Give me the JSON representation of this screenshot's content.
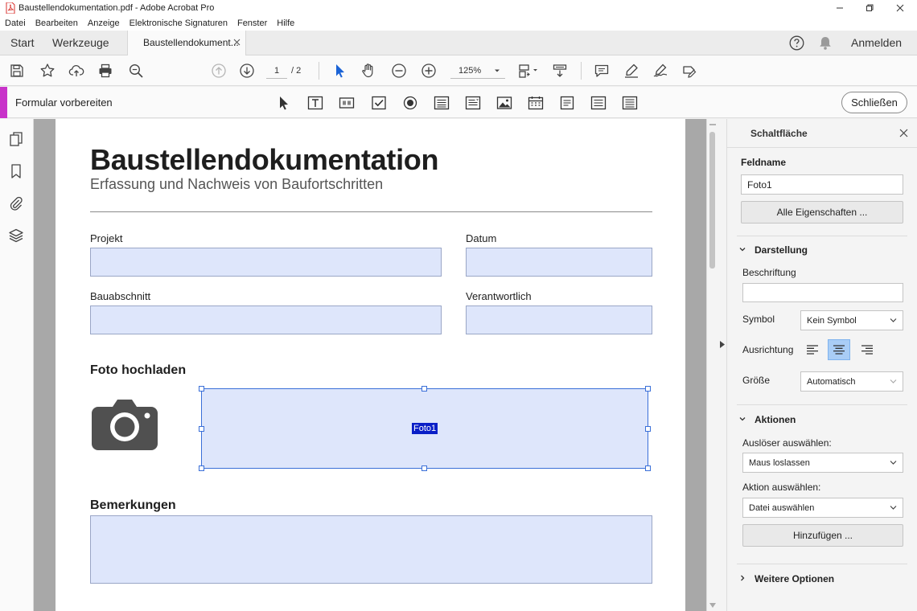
{
  "window": {
    "title": "Baustellendokumentation.pdf - Adobe Acrobat Pro"
  },
  "menu": [
    "Datei",
    "Bearbeiten",
    "Anzeige",
    "Elektronische Signaturen",
    "Fenster",
    "Hilfe"
  ],
  "tabs": {
    "start": "Start",
    "tools": "Werkzeuge",
    "document": "Baustellendokument...",
    "signin": "Anmelden"
  },
  "toolbar": {
    "page_current": "1",
    "page_total": "/ 2",
    "zoom": "125%"
  },
  "form_bar": {
    "title": "Formular vorbereiten",
    "close_label": "Schließen",
    "accent_color": "#c833c9"
  },
  "document": {
    "title": "Baustellendokumentation",
    "subtitle": "Erfassung und Nachweis von Baufortschritten",
    "labels": {
      "projekt": "Projekt",
      "datum": "Datum",
      "bauabschnitt": "Bauabschnitt",
      "verantwortlich": "Verantwortlich"
    },
    "photo_section": "Foto hochladen",
    "photo_field_tag": "Foto1",
    "remarks_section": "Bemerkungen"
  },
  "panel": {
    "header": "Schaltfläche",
    "field_name_label": "Feldname",
    "field_name_value": "Foto1",
    "all_properties": "Alle Eigenschaften ...",
    "appearance": {
      "title": "Darstellung",
      "caption_label": "Beschriftung",
      "caption_value": "",
      "symbol_label": "Symbol",
      "symbol_value": "Kein Symbol",
      "alignment_label": "Ausrichtung",
      "alignment_selected": "center",
      "size_label": "Größe",
      "size_value": "Automatisch"
    },
    "actions": {
      "title": "Aktionen",
      "trigger_label": "Auslöser auswählen:",
      "trigger_value": "Maus loslassen",
      "action_label": "Aktion auswählen:",
      "action_value": "Datei auswählen",
      "add_label": "Hinzufügen ..."
    },
    "more_options": "Weitere Optionen"
  },
  "colors": {
    "field_fill": "#dee6fb",
    "selection": "#3a6fd8",
    "active_align": "#a9cdf6"
  }
}
